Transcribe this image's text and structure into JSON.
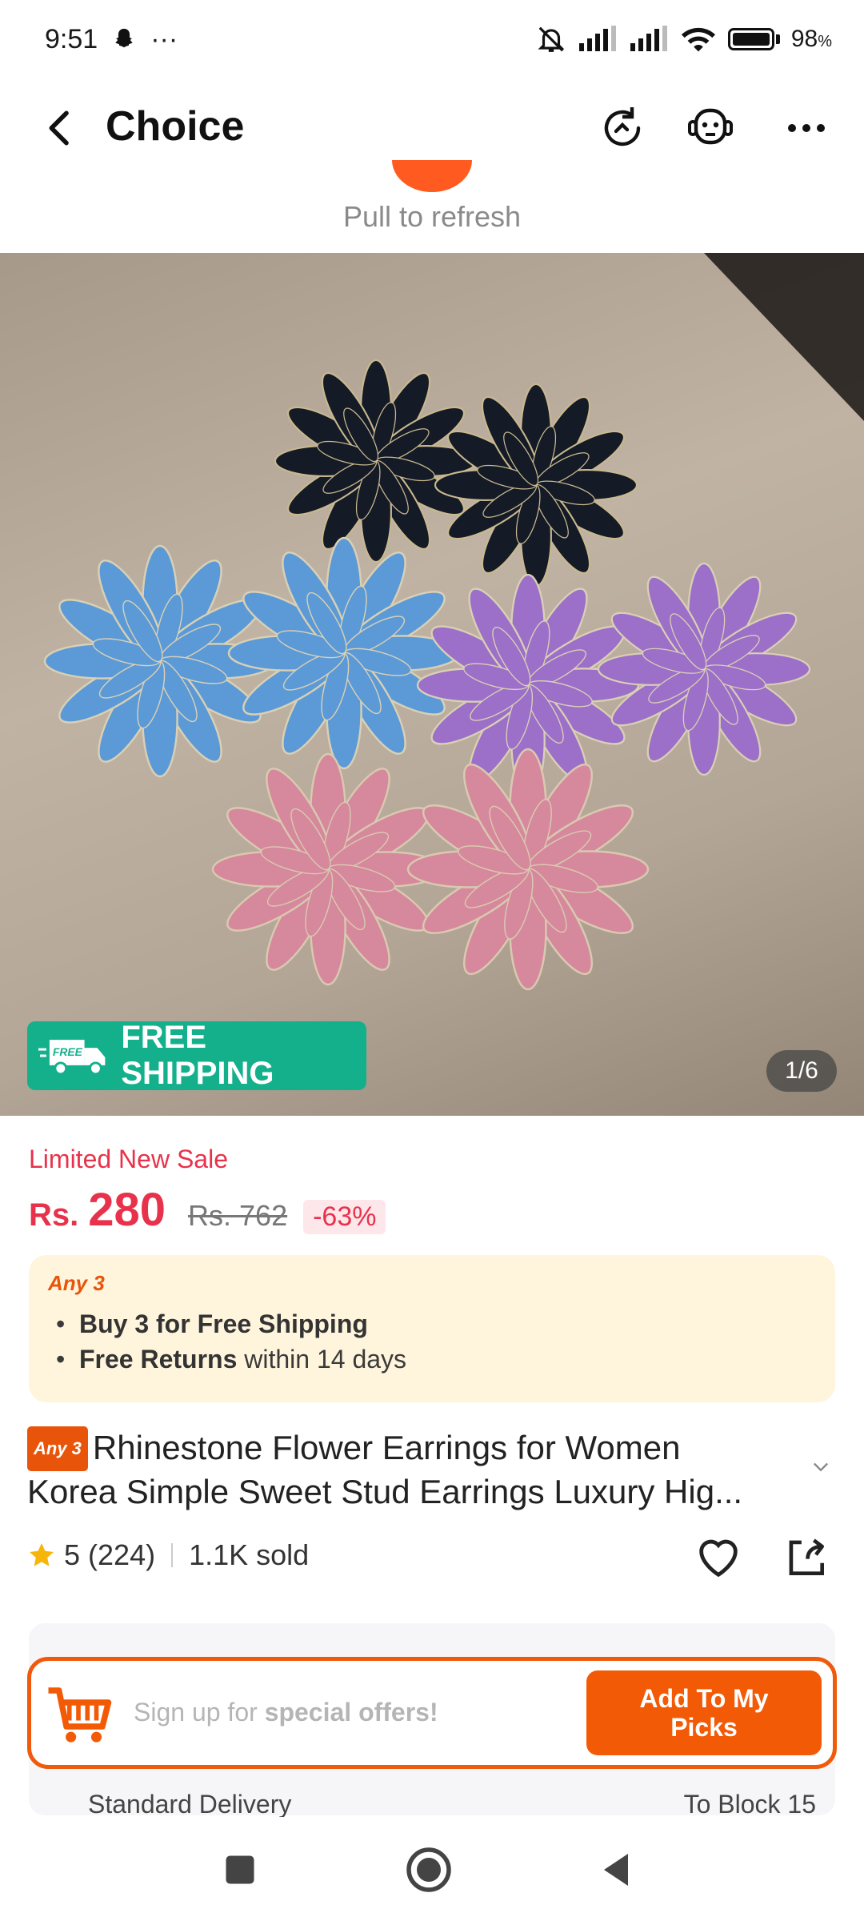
{
  "status": {
    "time": "9:51",
    "more": "···",
    "battery": "98",
    "battery_unit": "%"
  },
  "header": {
    "title": "Choice"
  },
  "pull": {
    "text": "Pull to refresh"
  },
  "image": {
    "free_badge": "FREE",
    "free_shipping": "FREE SHIPPING",
    "counter": "1/6"
  },
  "price": {
    "sale_label": "Limited New Sale",
    "currency": "Rs.",
    "current": "280",
    "original": "Rs. 762",
    "discount": "-63%"
  },
  "promo": {
    "tag": "Any 3",
    "line1_bold": "Buy 3 for  Free Shipping",
    "line2_bold": "Free Returns",
    "line2_rest": " within 14 days"
  },
  "product": {
    "badge": "Any 3",
    "title_line1": "Rhinestone Flower Earrings for Women",
    "title_line2": "Korea Simple Sweet Stud Earrings Luxury Hig..."
  },
  "rating": {
    "stars": "5",
    "count": "(224)",
    "sold": "1.1K sold"
  },
  "signup": {
    "prefix": "Sign up for ",
    "bold": "special offers!",
    "button": "Add To My Picks"
  },
  "delivery": {
    "label": "Standard Delivery",
    "destination": "To Block 15"
  },
  "colors": {
    "accent": "#f35a06",
    "price_red": "#e8324b",
    "free_green": "#14b08c",
    "promo_bg": "#fff5dc"
  }
}
